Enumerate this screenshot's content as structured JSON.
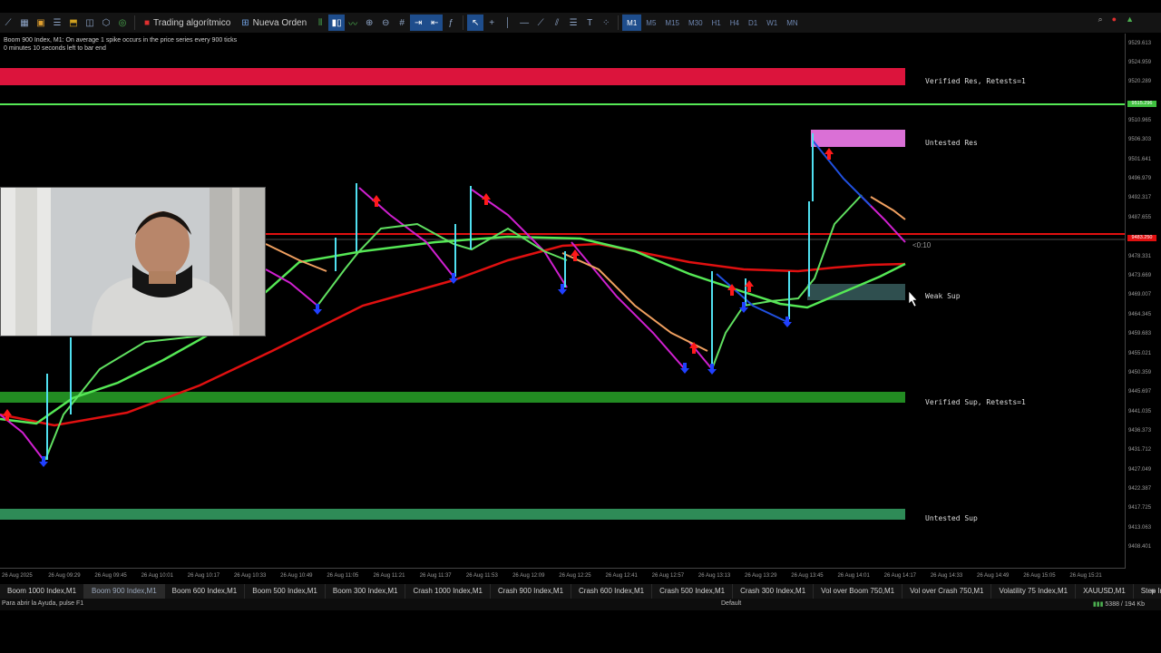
{
  "toolbar": {
    "algo_trading_label": "Trading algorítmico",
    "new_order_label": "Nueva Orden",
    "timeframes": [
      "M1",
      "M5",
      "M15",
      "M30",
      "H1",
      "H4",
      "D1",
      "W1",
      "MN"
    ],
    "active_timeframe": "M1"
  },
  "chart": {
    "info_line1": "Boom 900 Index, M1:  On average 1 spike occurs in the price series every 900 ticks",
    "info_line2": "0 minutes 10 seconds left to bar end",
    "countdown": "<0:10",
    "zones": [
      {
        "label": "Verified Res, Retests=1"
      },
      {
        "label": "Untested Res"
      },
      {
        "label": "Weak Sup"
      },
      {
        "label": "Verified Sup, Retests=1"
      },
      {
        "label": "Untested Sup"
      }
    ]
  },
  "price_axis": {
    "ticks": [
      "9529.613",
      "9524.959",
      "9520.289",
      "9515.296",
      "9510.965",
      "9506.303",
      "9501.641",
      "9496.979",
      "9492.317",
      "9487.655",
      "9482.993",
      "9478.331",
      "9473.669",
      "9469.007",
      "9464.345",
      "9459.683",
      "9455.021",
      "9450.359",
      "9445.697",
      "9441.035",
      "9436.373",
      "9431.712",
      "9427.049",
      "9422.387",
      "9417.725",
      "9413.063",
      "9408.401"
    ],
    "tag_green": "9515.296",
    "tag_red": "9483.250"
  },
  "time_axis": {
    "ticks": [
      "26 Aug 2025",
      "26 Aug 09:29",
      "26 Aug 09:45",
      "26 Aug 10:01",
      "26 Aug 10:17",
      "26 Aug 10:33",
      "26 Aug 10:49",
      "26 Aug 11:05",
      "26 Aug 11:21",
      "26 Aug 11:37",
      "26 Aug 11:53",
      "26 Aug 12:09",
      "26 Aug 12:25",
      "26 Aug 12:41",
      "26 Aug 12:57",
      "26 Aug 13:13",
      "26 Aug 13:29",
      "26 Aug 13:45",
      "26 Aug 14:01",
      "26 Aug 14:17",
      "26 Aug 14:33",
      "26 Aug 14:49",
      "26 Aug 15:05",
      "26 Aug 15:21"
    ]
  },
  "symbol_tabs": [
    "Boom 1000 Index,M1",
    "Boom 900 Index,M1",
    "Boom 600 Index,M1",
    "Boom 500 Index,M1",
    "Boom 300 Index,M1",
    "Crash 1000 Index,M1",
    "Crash 900 Index,M1",
    "Crash 600 Index,M1",
    "Crash 500 Index,M1",
    "Crash 300 Index,M1",
    "Vol over Boom 750,M1",
    "Vol over Crash 750,M1",
    "Volatility 75 Index,M1",
    "XAUUSD,M1",
    "Step Index,M"
  ],
  "active_tab": "Boom 900 Index,M1",
  "statusbar": {
    "help": "Para abrir la Ayuda, pulse F1",
    "profile": "Default",
    "network": "5388 / 194 Kb"
  },
  "colors": {
    "resistance_verified": "#dc143c",
    "resistance_untested": "#da70d6",
    "support_weak": "#2f4f4f",
    "support_verified": "#228b22",
    "support_untested": "#2e8b57",
    "ma_red": "#e01010",
    "ma_green": "#55e855"
  }
}
